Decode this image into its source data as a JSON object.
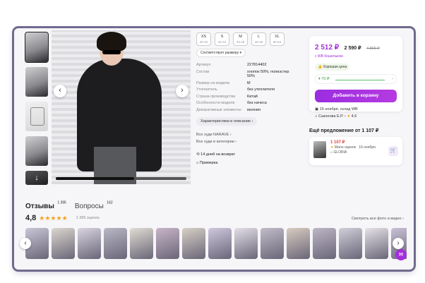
{
  "gallery": {
    "prev_icon": "chevron-left-icon",
    "next_icon": "chevron-right-icon",
    "video_progress": 0.6
  },
  "sizes": [
    {
      "label": "XS",
      "sub": "40-42"
    },
    {
      "label": "S",
      "sub": "42-44"
    },
    {
      "label": "M",
      "sub": "44-46"
    },
    {
      "label": "L",
      "sub": "46-48"
    },
    {
      "label": "XL",
      "sub": "50-54"
    }
  ],
  "size_chip": "Соответствует размеру",
  "specs": [
    {
      "k": "Артикул",
      "v": "227814402"
    },
    {
      "k": "Состав",
      "v": "хлопок 50%; полиэстер 50%"
    },
    {
      "k": "Размер на модели",
      "v": "M"
    },
    {
      "k": "Утеплитель",
      "v": "без утеплителя"
    },
    {
      "k": "Страна производства",
      "v": "Китай"
    },
    {
      "k": "Особенности модели",
      "v": "без начеса"
    },
    {
      "k": "Декоративные элементы",
      "v": "молния"
    }
  ],
  "chars_button": "Характеристики и описание",
  "links": [
    "Все худи NARAVE",
    "Все худи в категории"
  ],
  "meta": [
    "14 дней на возврат",
    "Примерка"
  ],
  "price": {
    "main": "2 512 ₽",
    "alt": "2 590 ₽",
    "old": "4 800 ₽",
    "wallet": "с WB Кошельком",
    "good_price": "Хорошая цена",
    "trend": "70 ₽",
    "add_to_cart": "Добавить в корзину",
    "delivery": "15 ноября, склад WB",
    "seller": "Сазонова Е.Р.",
    "seller_rating": "4,6"
  },
  "better_offer": {
    "title": "Ещё предложение от 1 107 ₽",
    "price": "1 107 ₽",
    "note": "Мало оценок",
    "date": "16 ноября",
    "seller": "GLORIA"
  },
  "reviews": {
    "title": "Отзывы",
    "count": "1 395",
    "questions": "Вопросы",
    "questions_count": "162",
    "rating": "4,8",
    "stars": "★★★★★",
    "ratings_count": "1 395 оценок",
    "see_all": "Смотреть все фото и видео"
  },
  "review_thumbs": [
    "#c9c6d6",
    "#dcd6cf",
    "#d9d4e0",
    "#b9b8c6",
    "#e0dcd2",
    "#c8b4c8",
    "#d6d0c6",
    "#cfc8dd",
    "#e3dfe8",
    "#c2bcc9",
    "#d8ccc0",
    "#bdb6c6",
    "#cfcfd8",
    "#e6e2e8",
    "#c9c0d6"
  ]
}
